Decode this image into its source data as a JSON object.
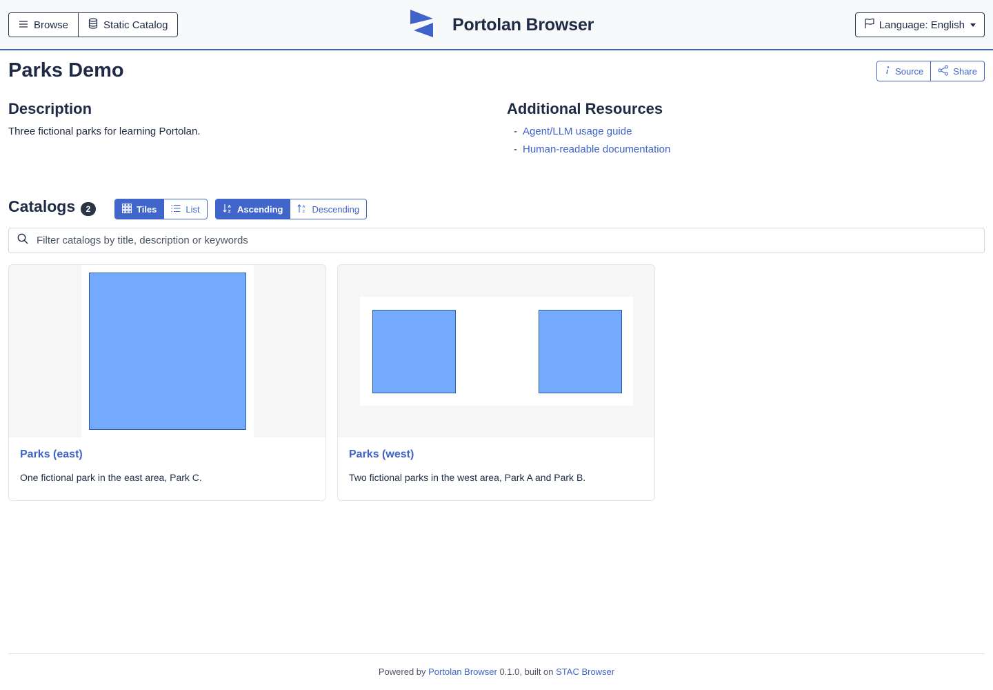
{
  "header": {
    "browse_label": "Browse",
    "static_catalog_label": "Static Catalog",
    "brand_title": "Portolan Browser",
    "language_label": "Language: English"
  },
  "page": {
    "title": "Parks Demo",
    "source_label": "Source",
    "share_label": "Share"
  },
  "description": {
    "heading": "Description",
    "text": "Three fictional parks for learning Portolan."
  },
  "resources": {
    "heading": "Additional Resources",
    "items": [
      {
        "label": "Agent/LLM usage guide"
      },
      {
        "label": "Human-readable documentation"
      }
    ]
  },
  "catalogs": {
    "heading": "Catalogs",
    "count": "2",
    "view_tiles": "Tiles",
    "view_list": "List",
    "sort_asc": "Ascending",
    "sort_desc": "Descending",
    "view_selected": "Tiles",
    "sort_selected": "Ascending",
    "search_placeholder": "Filter catalogs by title, description or keywords",
    "items": [
      {
        "title": "Parks (east)",
        "description": "One fictional park in the east area, Park C."
      },
      {
        "title": "Parks (west)",
        "description": "Two fictional parks in the west area, Park A and Park B."
      }
    ]
  },
  "footer": {
    "prefix": "Powered by ",
    "link1": "Portolan Browser",
    "middle": " 0.1.0, built on ",
    "link2": "STAC Browser"
  },
  "colors": {
    "accent": "#3f63c8",
    "header_bg": "#f8f9fb",
    "polygon_fill": "#73aafc",
    "text": "#1f2a44"
  }
}
